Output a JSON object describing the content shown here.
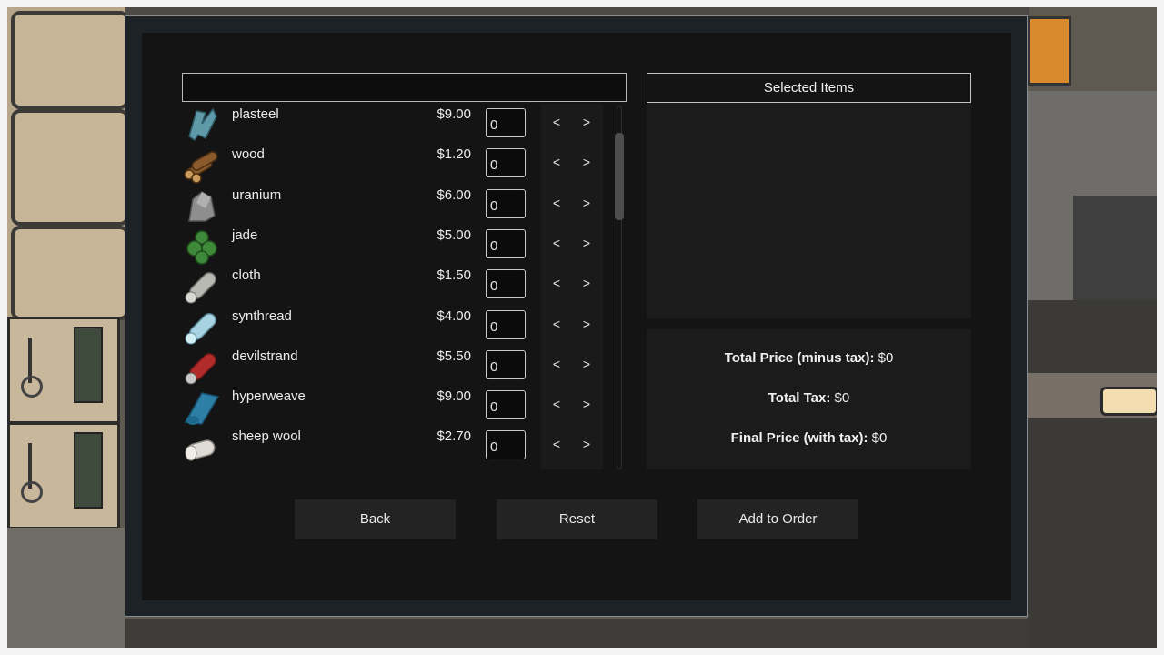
{
  "search": {
    "value": "",
    "placeholder": ""
  },
  "items": [
    {
      "name": "plasteel",
      "price": "$9.00",
      "qty": "0",
      "icon": "plasteel-icon",
      "color": "#5f9aa8"
    },
    {
      "name": "wood",
      "price": "$1.20",
      "qty": "0",
      "icon": "wood-logs-icon",
      "color": "#8a5a2b"
    },
    {
      "name": "uranium",
      "price": "$6.00",
      "qty": "0",
      "icon": "uranium-chunk-icon",
      "color": "#8e8e8e"
    },
    {
      "name": "jade",
      "price": "$5.00",
      "qty": "0",
      "icon": "jade-icon",
      "color": "#3f8a3a"
    },
    {
      "name": "cloth",
      "price": "$1.50",
      "qty": "0",
      "icon": "cloth-roll-icon",
      "color": "#b9b9b3"
    },
    {
      "name": "synthread",
      "price": "$4.00",
      "qty": "0",
      "icon": "synthread-roll-icon",
      "color": "#a8d3e0"
    },
    {
      "name": "devilstrand",
      "price": "$5.50",
      "qty": "0",
      "icon": "devilstrand-roll-icon",
      "color": "#b32c2c"
    },
    {
      "name": "hyperweave",
      "price": "$9.00",
      "qty": "0",
      "icon": "hyperweave-roll-icon",
      "color": "#2d7fa6"
    },
    {
      "name": "sheep wool",
      "price": "$2.70",
      "qty": "0",
      "icon": "wool-roll-icon",
      "color": "#dedcd4"
    }
  ],
  "arrows": {
    "decrease": "<",
    "increase": ">"
  },
  "selected": {
    "header": "Selected Items"
  },
  "totals": {
    "minus_tax_label": "Total Price (minus tax):",
    "minus_tax_value": "$0",
    "tax_label": "Total Tax:",
    "tax_value": "$0",
    "final_label": "Final Price (with tax):",
    "final_value": "$0"
  },
  "buttons": {
    "back": "Back",
    "reset": "Reset",
    "add": "Add to Order"
  }
}
